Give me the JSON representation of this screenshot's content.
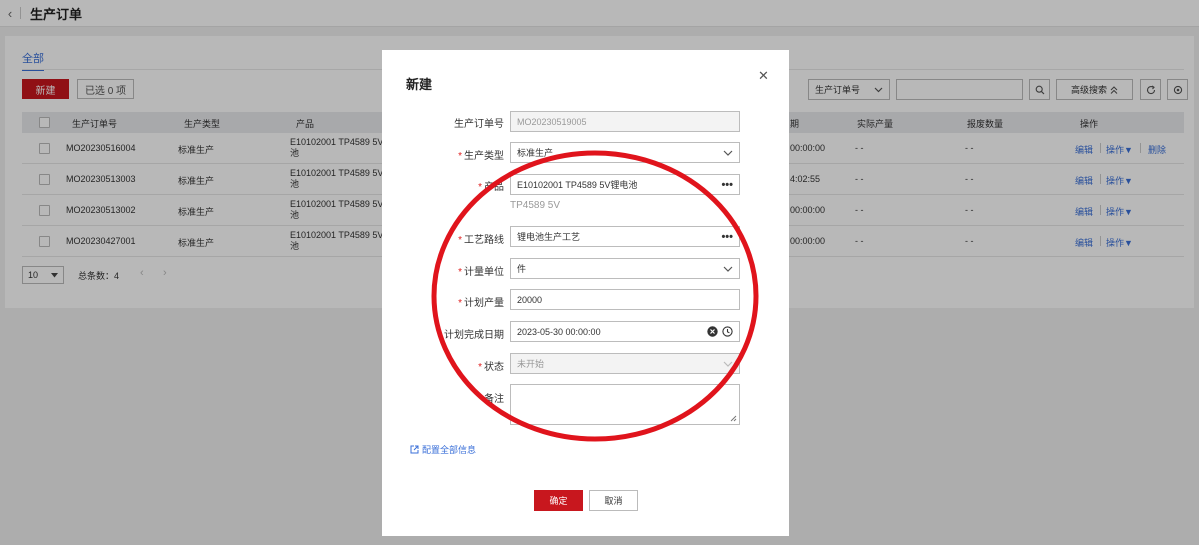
{
  "topbar": {
    "title": "生产订单"
  },
  "tabs": [
    {
      "label": "全部"
    }
  ],
  "toolbar": {
    "new_label": "新建",
    "selected_label": "已选 0 项",
    "filter_field": "生产订单号",
    "advanced_search": "高级搜索"
  },
  "table": {
    "headers": [
      "生产订单号",
      "生产类型",
      "产品",
      "期",
      "实际产量",
      "报废数量",
      "操作"
    ],
    "rows": [
      {
        "order_no": "MO20230516004",
        "type": "标准生产",
        "product_line1": "E10102001 TP4589 5V",
        "product_line2": "池",
        "date": "00:00:00",
        "actual": "- -",
        "scrap": "- -",
        "ops": [
          "编辑",
          "操作▼",
          "删除"
        ]
      },
      {
        "order_no": "MO20230513003",
        "type": "标准生产",
        "product_line1": "E10102001 TP4589 5V",
        "product_line2": "池",
        "date": "4:02:55",
        "actual": "- -",
        "scrap": "- -",
        "ops": [
          "编辑",
          "操作▼"
        ]
      },
      {
        "order_no": "MO20230513002",
        "type": "标准生产",
        "product_line1": "E10102001 TP4589 5V",
        "product_line2": "池",
        "date": "00:00:00",
        "actual": "- -",
        "scrap": "- -",
        "ops": [
          "编辑",
          "操作▼"
        ]
      },
      {
        "order_no": "MO20230427001",
        "type": "标准生产",
        "product_line1": "E10102001 TP4589 5V",
        "product_line2": "池",
        "date": "00:00:00",
        "actual": "- -",
        "scrap": "- -",
        "ops": [
          "编辑",
          "操作▼"
        ]
      }
    ]
  },
  "pager": {
    "page_size": "10",
    "total": "总条数：4",
    "prev": "‹",
    "next": "›"
  },
  "dialog": {
    "title": "新建",
    "fields": {
      "order_no": {
        "label": "生产订单号",
        "value": "MO20230519005"
      },
      "type": {
        "label": "生产类型",
        "value": "标准生产"
      },
      "product": {
        "label": "产品",
        "value": "E10102001 TP4589 5V锂电池",
        "hint": "TP4589 5V"
      },
      "route": {
        "label": "工艺路线",
        "value": "锂电池生产工艺"
      },
      "unit": {
        "label": "计量单位",
        "value": "件"
      },
      "qty": {
        "label": "计划产量",
        "value": "20000"
      },
      "due": {
        "label": "计划完成日期",
        "value": "2023-05-30 00:00:00"
      },
      "status": {
        "label": "状态",
        "value": "未开始"
      },
      "remark": {
        "label": "备注",
        "value": ""
      }
    },
    "config_link": "配置全部信息",
    "ok_label": "确定",
    "cancel_label": "取消"
  },
  "colors": {
    "primary_red": "#c8171e",
    "link_blue": "#3a6fd8",
    "annotation_red": "#e0141c"
  }
}
